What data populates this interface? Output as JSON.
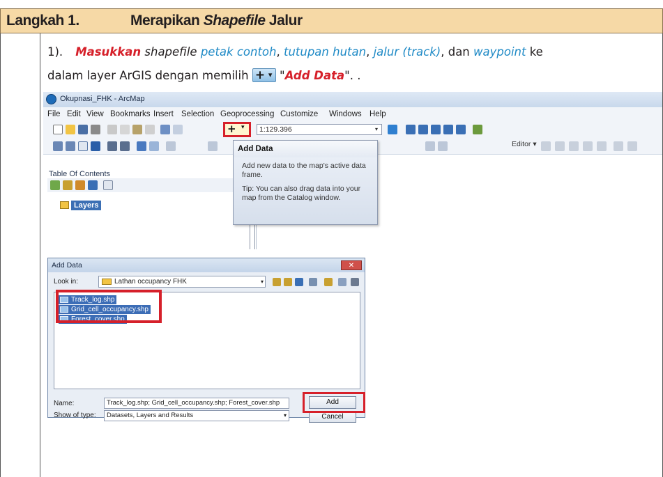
{
  "header": {
    "step_label": "Langkah 1.",
    "title_pre": "Merapikan ",
    "title_italic": "Shapefile",
    "title_post": " Jalur"
  },
  "instruction": {
    "number": "1).",
    "verb": "Masukkan",
    "t1": " shapefile ",
    "l1": "petak contoh",
    "t2": ", ",
    "l2": "tutupan hutan",
    "t3": ", ",
    "l3": "jalur (track)",
    "t4": ", dan ",
    "l4": "waypoint",
    "t5": " ke",
    "line2_pre": "dalam layer ArGIS dengan memilih ",
    "quote_open": " \"",
    "action": "Add Data",
    "line2_post": "\".   ."
  },
  "arcmap": {
    "window_title": "Okupnasi_FHK - ArcMap",
    "menus": [
      "File",
      "Edit",
      "View",
      "Bookmarks",
      "Insert",
      "Selection",
      "Geoprocessing",
      "Customize",
      "Windows",
      "Help"
    ],
    "scale": "1:129.396",
    "editor_label": "Editor ▾",
    "toc_title": "Table Of Contents",
    "layers_label": "Layers",
    "tooltip": {
      "title": "Add Data",
      "desc": "Add new data to the map's active data frame.",
      "tip": "Tip: You can also drag data into your map from the Catalog window."
    }
  },
  "dialog": {
    "title": "Add Data",
    "look_in_label": "Look in:",
    "look_in_value": "Lathan occupancy FHK",
    "files": [
      "Track_log.shp",
      "Grid_cell_occupancy.shp",
      "Forest_cover.shp"
    ],
    "name_label": "Name:",
    "name_value": "Track_log.shp; Grid_cell_occupancy.shp; Forest_cover.shp",
    "type_label": "Show of type:",
    "type_value": "Datasets, Layers and Results",
    "add_label": "Add",
    "cancel_label": "Cancel"
  },
  "colors": {
    "header_bg": "#f6d9a6",
    "highlight_red": "#d6202a",
    "link_blue": "#1f8ac6",
    "selection_blue": "#3c6db6"
  }
}
